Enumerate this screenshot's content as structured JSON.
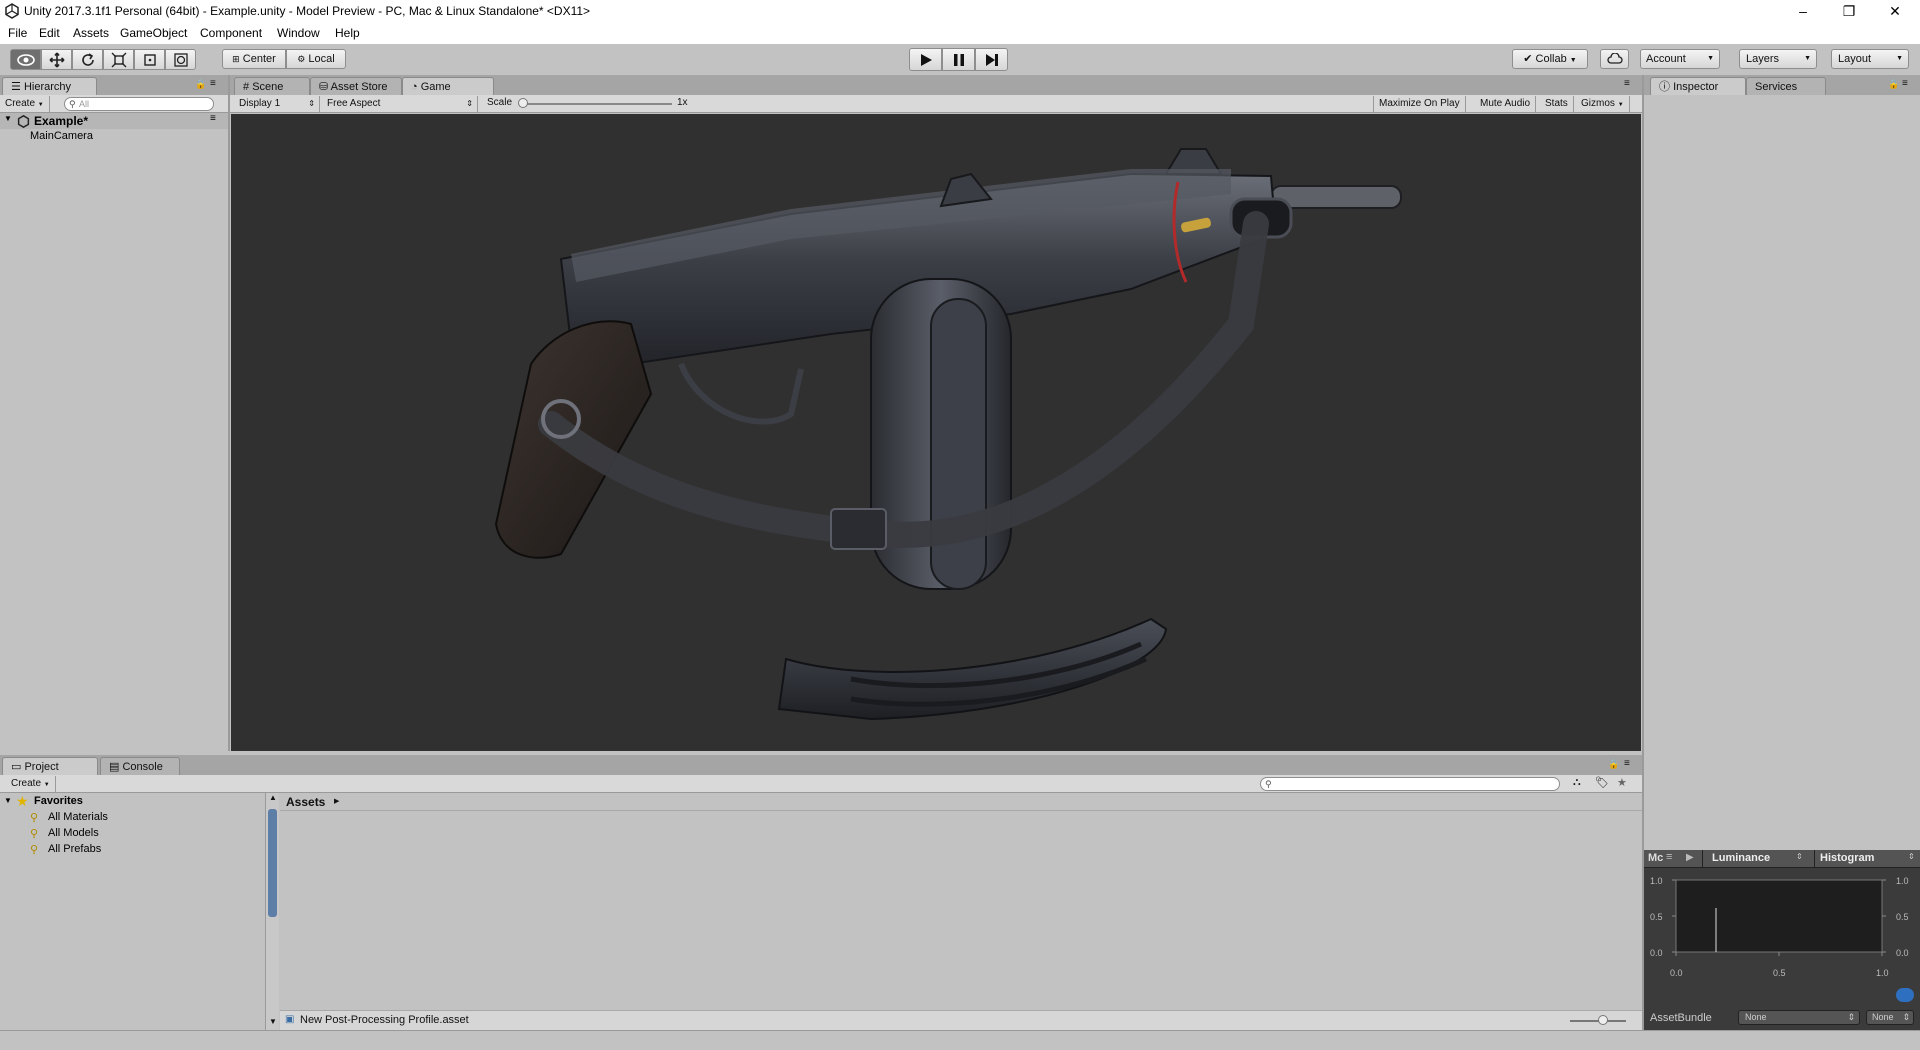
{
  "window": {
    "title": "Unity 2017.3.1f1 Personal (64bit) - Example.unity - Model Preview - PC, Mac & Linux Standalone* <DX11>",
    "minimize": "–",
    "maximize": "❐",
    "close": "✕"
  },
  "menu": [
    "File",
    "Edit",
    "Assets",
    "GameObject",
    "Component",
    "Window",
    "Help"
  ],
  "toolbar": {
    "pivot_label": "Center",
    "space_label": "Local",
    "collab_label": "Collab",
    "account_label": "Account",
    "layers_label": "Layers",
    "layout_label": "Layout"
  },
  "hierarchy": {
    "tab_label": "Hierarchy",
    "create_label": "Create",
    "search_placeholder": "All",
    "scene_name": "Example*",
    "items": [
      "MainCamera"
    ]
  },
  "center": {
    "tabs": [
      "Scene",
      "Asset Store",
      "Game"
    ],
    "display_label": "Display 1",
    "aspect_label": "Free Aspect",
    "scale_label": "Scale",
    "scale_value": "1x",
    "options": [
      "Maximize On Play",
      "Mute Audio",
      "Stats",
      "Gizmos"
    ],
    "viewport_color": "#303030"
  },
  "inspector": {
    "tabs": [
      "Inspector",
      "Services"
    ]
  },
  "project": {
    "tabs": [
      "Project",
      "Console"
    ],
    "create_label": "Create",
    "favorites_label": "Favorites",
    "favorites": [
      "All Materials",
      "All Models",
      "All Prefabs"
    ],
    "breadcrumb": "Assets",
    "status_file": "New Post-Processing Profile.asset"
  },
  "histogram": {
    "mode_label": "Mc",
    "channel_label": "Luminance",
    "view_label": "Histogram",
    "y_ticks": [
      "1.0",
      "0.5",
      "0.0"
    ],
    "x_ticks": [
      "0.0",
      "0.5",
      "1.0"
    ],
    "asset_bundle_label": "AssetBundle",
    "bundle_name": "None",
    "bundle_variant": "None"
  }
}
